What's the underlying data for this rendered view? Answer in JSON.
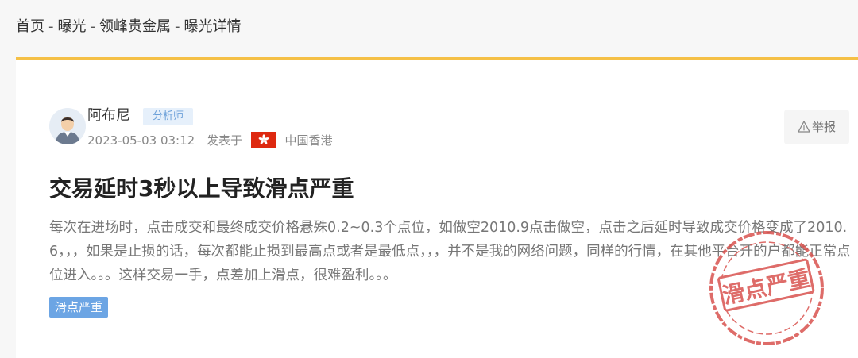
{
  "breadcrumb": {
    "items": [
      "首页",
      "曝光",
      "领峰贵金属",
      "曝光详情"
    ],
    "separator": "-"
  },
  "author": {
    "name": "阿布尼",
    "role": "分析师",
    "avatar_icon": "user-avatar-icon"
  },
  "post": {
    "date": "2023-05-03 03:12",
    "published_label": "发表于",
    "location": "中国香港",
    "location_flag_icon": "hong-kong-flag-icon",
    "report_label": "举报",
    "title": "交易延时3秒以上导致滑点严重",
    "body": "每次在进场时，点击成交和最终成交价格悬殊0.2~0.3个点位，如做空2010.9点击做空，点击之后延时导致成交价格变成了2010.6，，，如果是止损的话，每次都能止损到最高点或者是最低点，，，并不是我的网络问题，同样的行情，在其他平台开的户都能正常点位进入。。。这样交易一手，点差加上滑点，很难盈利。。。",
    "tag": "滑点严重",
    "stamp_text": "滑点严重"
  },
  "colors": {
    "accent_bar": "#f5c046",
    "tag_bg": "#6ca5e4",
    "badge_bg": "#e6f0fb",
    "badge_text": "#6a9fd8",
    "stamp": "#d9534f"
  }
}
